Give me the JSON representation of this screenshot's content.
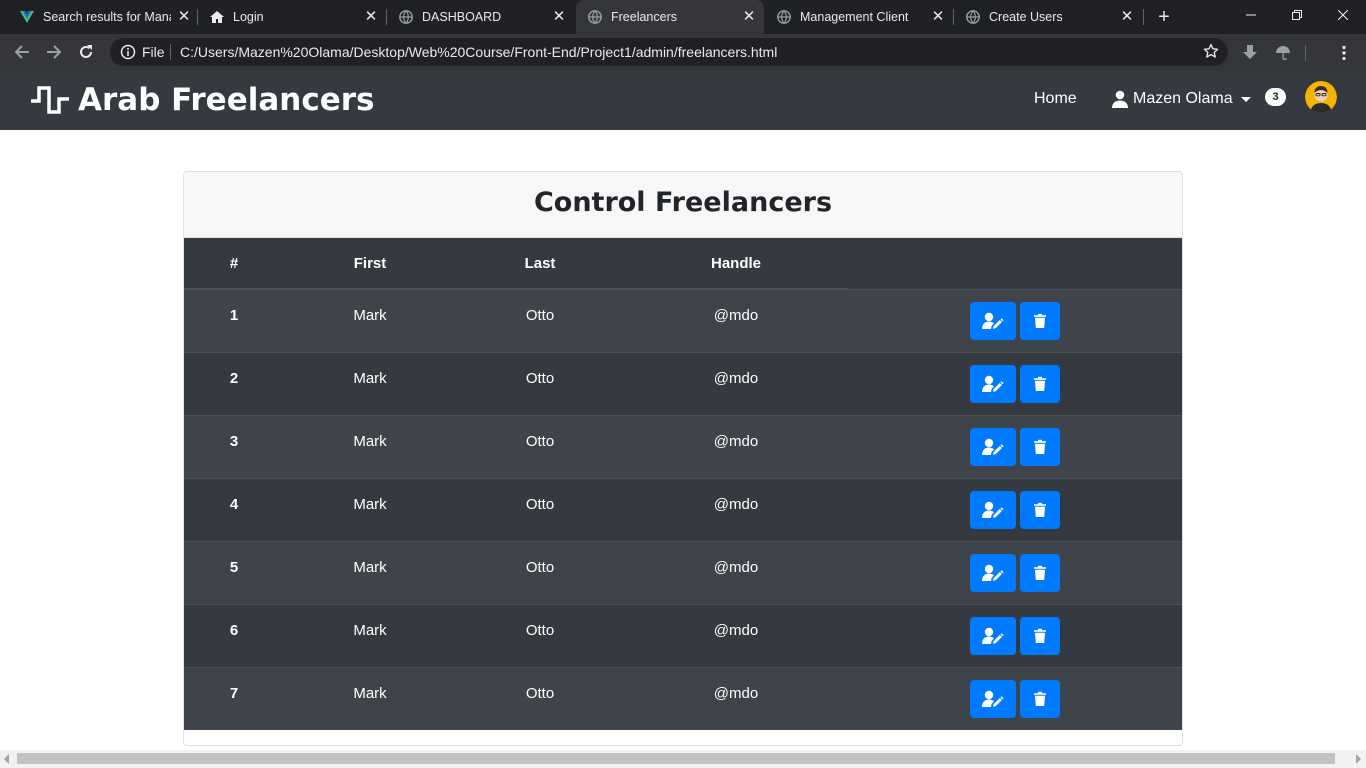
{
  "browser": {
    "tabs": [
      {
        "title": "Search results for Mana",
        "favicon": "vuetify-icon",
        "active": false
      },
      {
        "title": "Login",
        "favicon": "home-icon",
        "active": false
      },
      {
        "title": "DASHBOARD",
        "favicon": "globe-icon",
        "active": false
      },
      {
        "title": "Freelancers",
        "favicon": "globe-icon",
        "active": true
      },
      {
        "title": "Management Client",
        "favicon": "globe-icon",
        "active": false
      },
      {
        "title": "Create Users",
        "favicon": "globe-icon",
        "active": false
      }
    ],
    "close_glyph": "✕",
    "new_tab_glyph": "+",
    "address": {
      "scheme_label": "File",
      "url": "C:/Users/Mazen%20Olama/Desktop/Web%20Course/Front-End/Project1/admin/freelancers.html"
    }
  },
  "navbar": {
    "brand": "Arab Freelancers",
    "home_link": "Home",
    "user_name": "Mazen Olama",
    "notification_count": "3"
  },
  "card": {
    "title": "Control Freelancers"
  },
  "table": {
    "headers": [
      "#",
      "First",
      "Last",
      "Handle"
    ],
    "rows": [
      {
        "num": "1",
        "first": "Mark",
        "last": "Otto",
        "handle": "@mdo"
      },
      {
        "num": "2",
        "first": "Mark",
        "last": "Otto",
        "handle": "@mdo"
      },
      {
        "num": "3",
        "first": "Mark",
        "last": "Otto",
        "handle": "@mdo"
      },
      {
        "num": "4",
        "first": "Mark",
        "last": "Otto",
        "handle": "@mdo"
      },
      {
        "num": "5",
        "first": "Mark",
        "last": "Otto",
        "handle": "@mdo"
      },
      {
        "num": "6",
        "first": "Mark",
        "last": "Otto",
        "handle": "@mdo"
      },
      {
        "num": "7",
        "first": "Mark",
        "last": "Otto",
        "handle": "@mdo"
      }
    ],
    "action_icons": [
      "user-edit-icon",
      "trash-icon"
    ]
  },
  "colors": {
    "navbar_bg": "#343a40",
    "row_alt_bg": "#3e444a",
    "button_primary": "#007bff",
    "browser_tabstrip": "#202124",
    "browser_toolbar": "#35363a"
  }
}
